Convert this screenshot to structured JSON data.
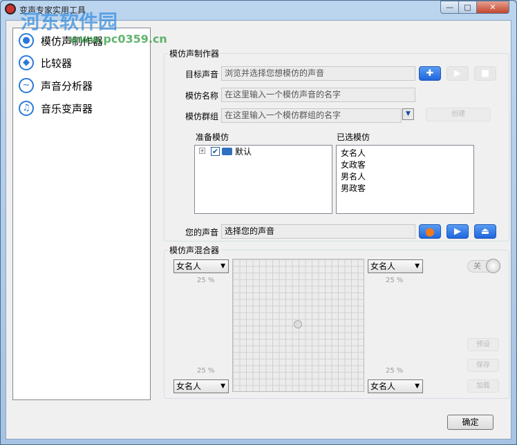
{
  "window": {
    "title": "变声专家实用工具",
    "minimize": "—",
    "maximize": "□",
    "close": "✕"
  },
  "watermark": {
    "name": "河东软件园",
    "url": "www.pc0359.cn"
  },
  "sidebar": {
    "items": [
      {
        "label": "模仿声制作器",
        "icon": "mic-icon"
      },
      {
        "label": "比较器",
        "icon": "lips-icon"
      },
      {
        "label": "声音分析器",
        "icon": "analyzer-icon"
      },
      {
        "label": "音乐变声器",
        "icon": "music-icon"
      }
    ]
  },
  "maker": {
    "title": "模仿声制作器",
    "target_label": "目标声音",
    "target_placeholder": "浏览并选择您想模仿的声音",
    "name_label": "模仿名称",
    "name_placeholder": "在这里输入一个模仿声音的名字",
    "group_label": "模仿群组",
    "group_placeholder": "在这里输入一个模仿群组的名字",
    "create": "创建",
    "ready_label": "准备模仿",
    "tree_expand": "+",
    "tree_item": "默认",
    "selected_label": "已选模仿",
    "selected_items": [
      "女名人",
      "女政客",
      "男名人",
      "男政客"
    ],
    "your_voice_label": "您的声音",
    "your_voice_value": "选择您的声音"
  },
  "mixer": {
    "title": "模仿声混合器",
    "top_left": "女名人",
    "top_right": "女名人",
    "bottom_left": "女名人",
    "bottom_right": "女名人",
    "pct_tl": "25 %",
    "pct_tr": "25 %",
    "pct_bl": "25 %",
    "pct_br": "25 %",
    "toggle": "关",
    "preset": "预设",
    "save": "保存",
    "load": "加载"
  },
  "ok": "确定"
}
